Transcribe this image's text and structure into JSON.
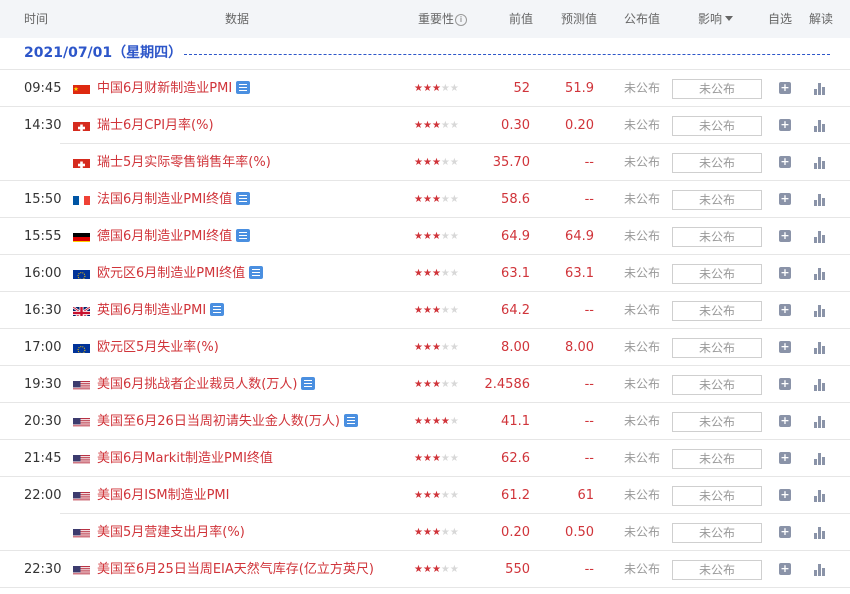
{
  "header": {
    "time": "时间",
    "data": "数据",
    "importance": "重要性",
    "importance_help_icon": "i",
    "previous": "前值",
    "forecast": "预测值",
    "actual": "公布值",
    "impact": "影响",
    "watch": "自选",
    "interpret": "解读"
  },
  "date_label": "2021/07/01（星期四）",
  "colors": {
    "accent": "#2d56c9",
    "event": "#d0343a",
    "star_off": "#d8d8d8"
  },
  "rows": [
    {
      "time": "09:45",
      "flag": "cn",
      "name": "中国6月财新制造业PMI",
      "doc": true,
      "stars": 3,
      "prev": "52",
      "fore": "51.9",
      "actual": "未公布",
      "impact": "未公布"
    },
    {
      "time": "14:30",
      "flag": "ch",
      "name": "瑞士6月CPI月率(%)",
      "doc": false,
      "stars": 3,
      "prev": "0.30",
      "fore": "0.20",
      "actual": "未公布",
      "impact": "未公布"
    },
    {
      "time": "",
      "flag": "ch",
      "name": "瑞士5月实际零售销售年率(%)",
      "doc": false,
      "stars": 3,
      "prev": "35.70",
      "fore": "--",
      "actual": "未公布",
      "impact": "未公布"
    },
    {
      "time": "15:50",
      "flag": "fr",
      "name": "法国6月制造业PMI终值",
      "doc": true,
      "stars": 3,
      "prev": "58.6",
      "fore": "--",
      "actual": "未公布",
      "impact": "未公布"
    },
    {
      "time": "15:55",
      "flag": "de",
      "name": "德国6月制造业PMI终值",
      "doc": true,
      "stars": 3,
      "prev": "64.9",
      "fore": "64.9",
      "actual": "未公布",
      "impact": "未公布"
    },
    {
      "time": "16:00",
      "flag": "eu",
      "name": "欧元区6月制造业PMI终值",
      "doc": true,
      "stars": 3,
      "prev": "63.1",
      "fore": "63.1",
      "actual": "未公布",
      "impact": "未公布"
    },
    {
      "time": "16:30",
      "flag": "gb",
      "name": "英国6月制造业PMI",
      "doc": true,
      "stars": 3,
      "prev": "64.2",
      "fore": "--",
      "actual": "未公布",
      "impact": "未公布"
    },
    {
      "time": "17:00",
      "flag": "eu",
      "name": "欧元区5月失业率(%)",
      "doc": false,
      "stars": 3,
      "prev": "8.00",
      "fore": "8.00",
      "actual": "未公布",
      "impact": "未公布"
    },
    {
      "time": "19:30",
      "flag": "us",
      "name": "美国6月挑战者企业裁员人数(万人)",
      "doc": true,
      "stars": 3,
      "prev": "2.4586",
      "fore": "--",
      "actual": "未公布",
      "impact": "未公布"
    },
    {
      "time": "20:30",
      "flag": "us",
      "name": "美国至6月26日当周初请失业金人数(万人)",
      "doc": true,
      "stars": 4,
      "prev": "41.1",
      "fore": "--",
      "actual": "未公布",
      "impact": "未公布"
    },
    {
      "time": "21:45",
      "flag": "us",
      "name": "美国6月Markit制造业PMI终值",
      "doc": false,
      "stars": 3,
      "prev": "62.6",
      "fore": "--",
      "actual": "未公布",
      "impact": "未公布"
    },
    {
      "time": "22:00",
      "flag": "us",
      "name": "美国6月ISM制造业PMI",
      "doc": false,
      "stars": 3,
      "prev": "61.2",
      "fore": "61",
      "actual": "未公布",
      "impact": "未公布"
    },
    {
      "time": "",
      "flag": "us",
      "name": "美国5月营建支出月率(%)",
      "doc": false,
      "stars": 3,
      "prev": "0.20",
      "fore": "0.50",
      "actual": "未公布",
      "impact": "未公布"
    },
    {
      "time": "22:30",
      "flag": "us",
      "name": "美国至6月25日当周EIA天然气库存(亿立方英尺)",
      "doc": false,
      "stars": 3,
      "prev": "550",
      "fore": "--",
      "actual": "未公布",
      "impact": "未公布"
    }
  ]
}
